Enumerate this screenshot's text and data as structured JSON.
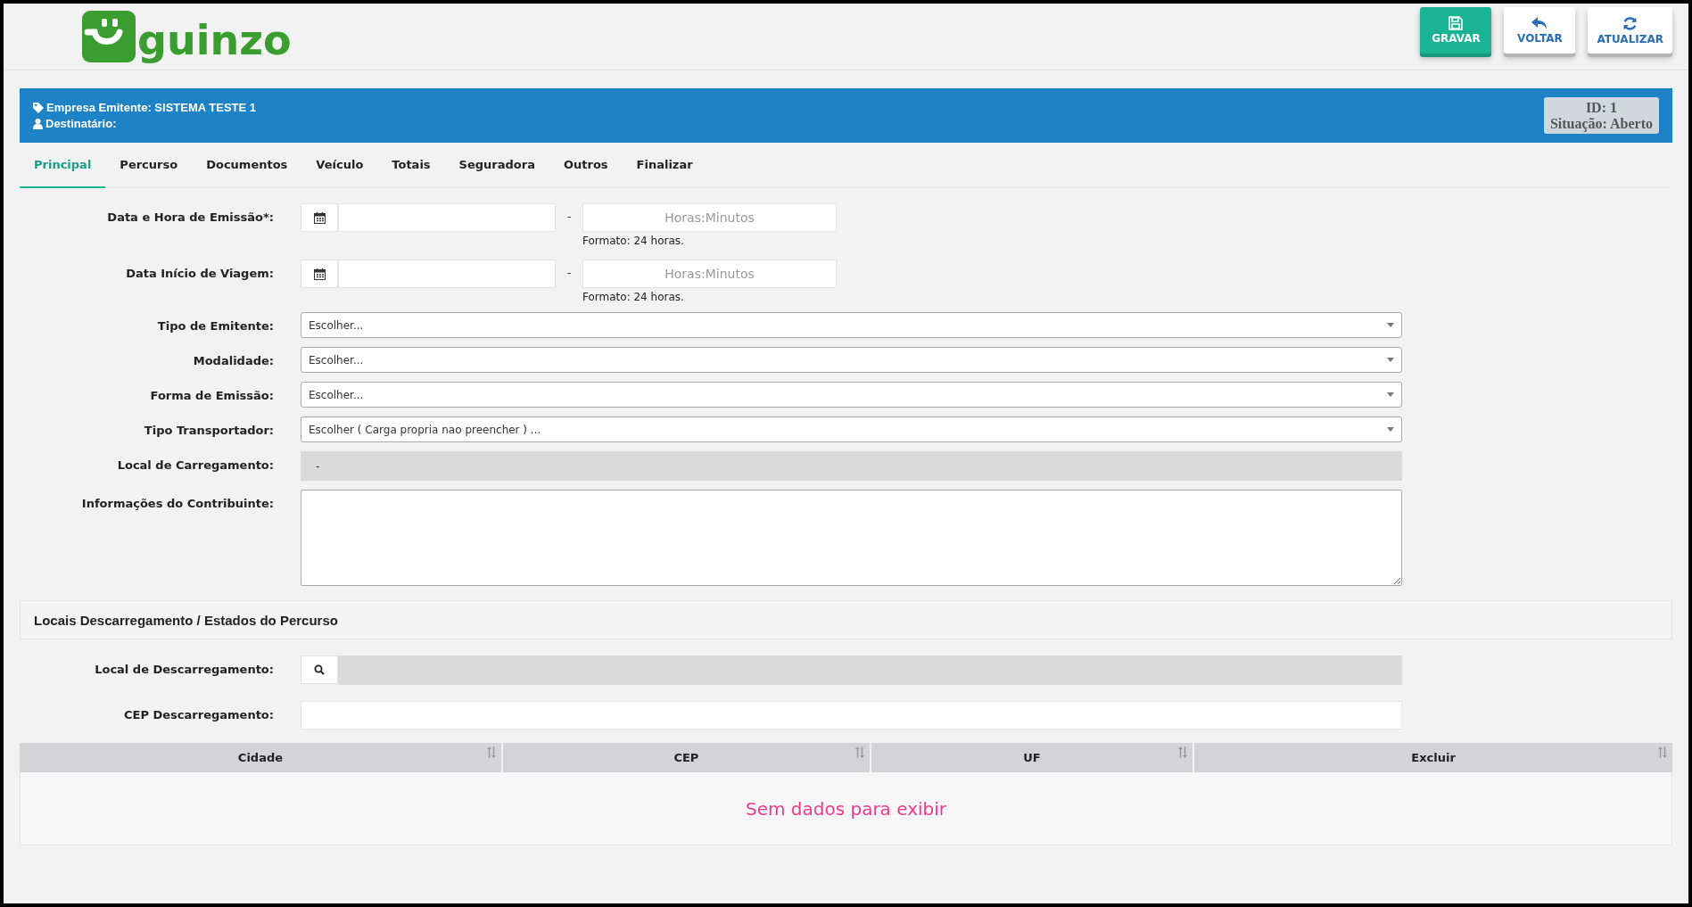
{
  "logo": {
    "text": "guinzo"
  },
  "toolbar": [
    {
      "label": "GRAVAR",
      "kind": "primary"
    },
    {
      "label": "VOLTAR",
      "kind": "default"
    },
    {
      "label": "ATUALIZAR",
      "kind": "default"
    }
  ],
  "banner": {
    "issuer": "Empresa Emitente: SISTEMA TESTE 1",
    "recipient": "Destinatário:",
    "id": "ID: 1",
    "status": "Situação: Aberto"
  },
  "tabs": [
    {
      "label": "Principal",
      "selected": true
    },
    {
      "label": "Percurso",
      "selected": false
    },
    {
      "label": "Documentos",
      "selected": false
    },
    {
      "label": "Veículo",
      "selected": false
    },
    {
      "label": "Totais",
      "selected": false
    },
    {
      "label": "Seguradora",
      "selected": false
    },
    {
      "label": "Outros",
      "selected": false
    },
    {
      "label": "Finalizar",
      "selected": false
    }
  ],
  "form": {
    "fields": [
      {
        "kind": "datetime",
        "label": "Data e Hora de Emissão*:",
        "separator": "-",
        "time_placeholder": "Horas:Minutos",
        "hint": "Formato: 24 horas."
      },
      {
        "kind": "datetime",
        "label": "Data Início de Viagem:",
        "separator": "-",
        "time_placeholder": "Horas:Minutos",
        "hint": "Formato: 24 horas."
      },
      {
        "kind": "select",
        "label": "Tipo de Emitente:",
        "value": "Escolher..."
      },
      {
        "kind": "select",
        "label": "Modalidade:",
        "value": "Escolher..."
      },
      {
        "kind": "select",
        "label": "Forma de Emissão:",
        "value": "Escolher..."
      },
      {
        "kind": "select",
        "label": "Tipo Transportador:",
        "value": "Escolher ( Carga propria nao preencher ) ..."
      },
      {
        "kind": "readonly",
        "label": "Local de Carregamento:",
        "value": "-"
      },
      {
        "kind": "textarea",
        "label": "Informações do Contribuinte:"
      }
    ]
  },
  "section": {
    "title": "Locais Descarregamento / Estados do Percurso",
    "fields": [
      {
        "kind": "search",
        "label": "Local de Descarregamento:"
      },
      {
        "kind": "text",
        "label": "CEP Descarregamento:"
      }
    ]
  },
  "table": {
    "columns": [
      "Cidade",
      "CEP",
      "UF",
      "Excluir"
    ],
    "empty_message": "Sem dados para exibir"
  }
}
